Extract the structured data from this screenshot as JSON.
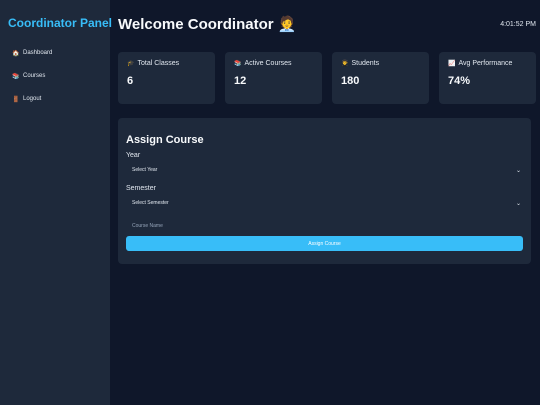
{
  "sidebar": {
    "brand": "Coordinator Panel",
    "items": [
      {
        "icon": "🏠",
        "label": "Dashboard"
      },
      {
        "icon": "📚",
        "label": "Courses"
      },
      {
        "icon": "🚪",
        "label": "Logout"
      }
    ]
  },
  "header": {
    "title": "Welcome Coordinator 🧑‍💼",
    "time": "4:01:52 PM"
  },
  "stats": [
    {
      "icon": "🎓",
      "label": "Total Classes",
      "value": "6"
    },
    {
      "icon": "📚",
      "label": "Active Courses",
      "value": "12"
    },
    {
      "icon": "👨‍🎓",
      "label": "Students",
      "value": "180"
    },
    {
      "icon": "📈",
      "label": "Avg Performance",
      "value": "74%"
    }
  ],
  "assign": {
    "title": "Assign Course",
    "year_label": "Year",
    "year_selected": "Select Year",
    "semester_label": "Semester",
    "semester_selected": "Select Semester",
    "course_placeholder": "Course Name",
    "button_label": "Assign Course"
  },
  "colors": {
    "background": "#0f172a",
    "panel": "#1e293b",
    "accent": "#38bdf8"
  }
}
